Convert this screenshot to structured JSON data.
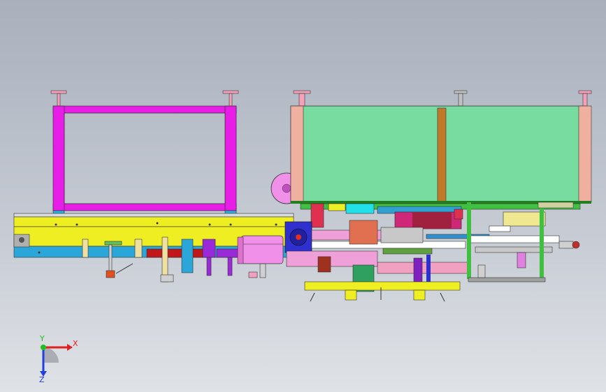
{
  "viewport": {
    "background_top": "#a9b0bc",
    "background_bottom": "#dfe2e6"
  },
  "triad": {
    "x_label": "X",
    "y_label": "Y",
    "z_label": "Z",
    "x_color": "#e02020",
    "y_color": "#20c020",
    "z_color": "#2040e0"
  },
  "model": {
    "frame_color": "#e81ee8",
    "cabinet_color": "#78dca0",
    "base_color": "#eeee22",
    "rail_color": "#2aa7d8"
  }
}
